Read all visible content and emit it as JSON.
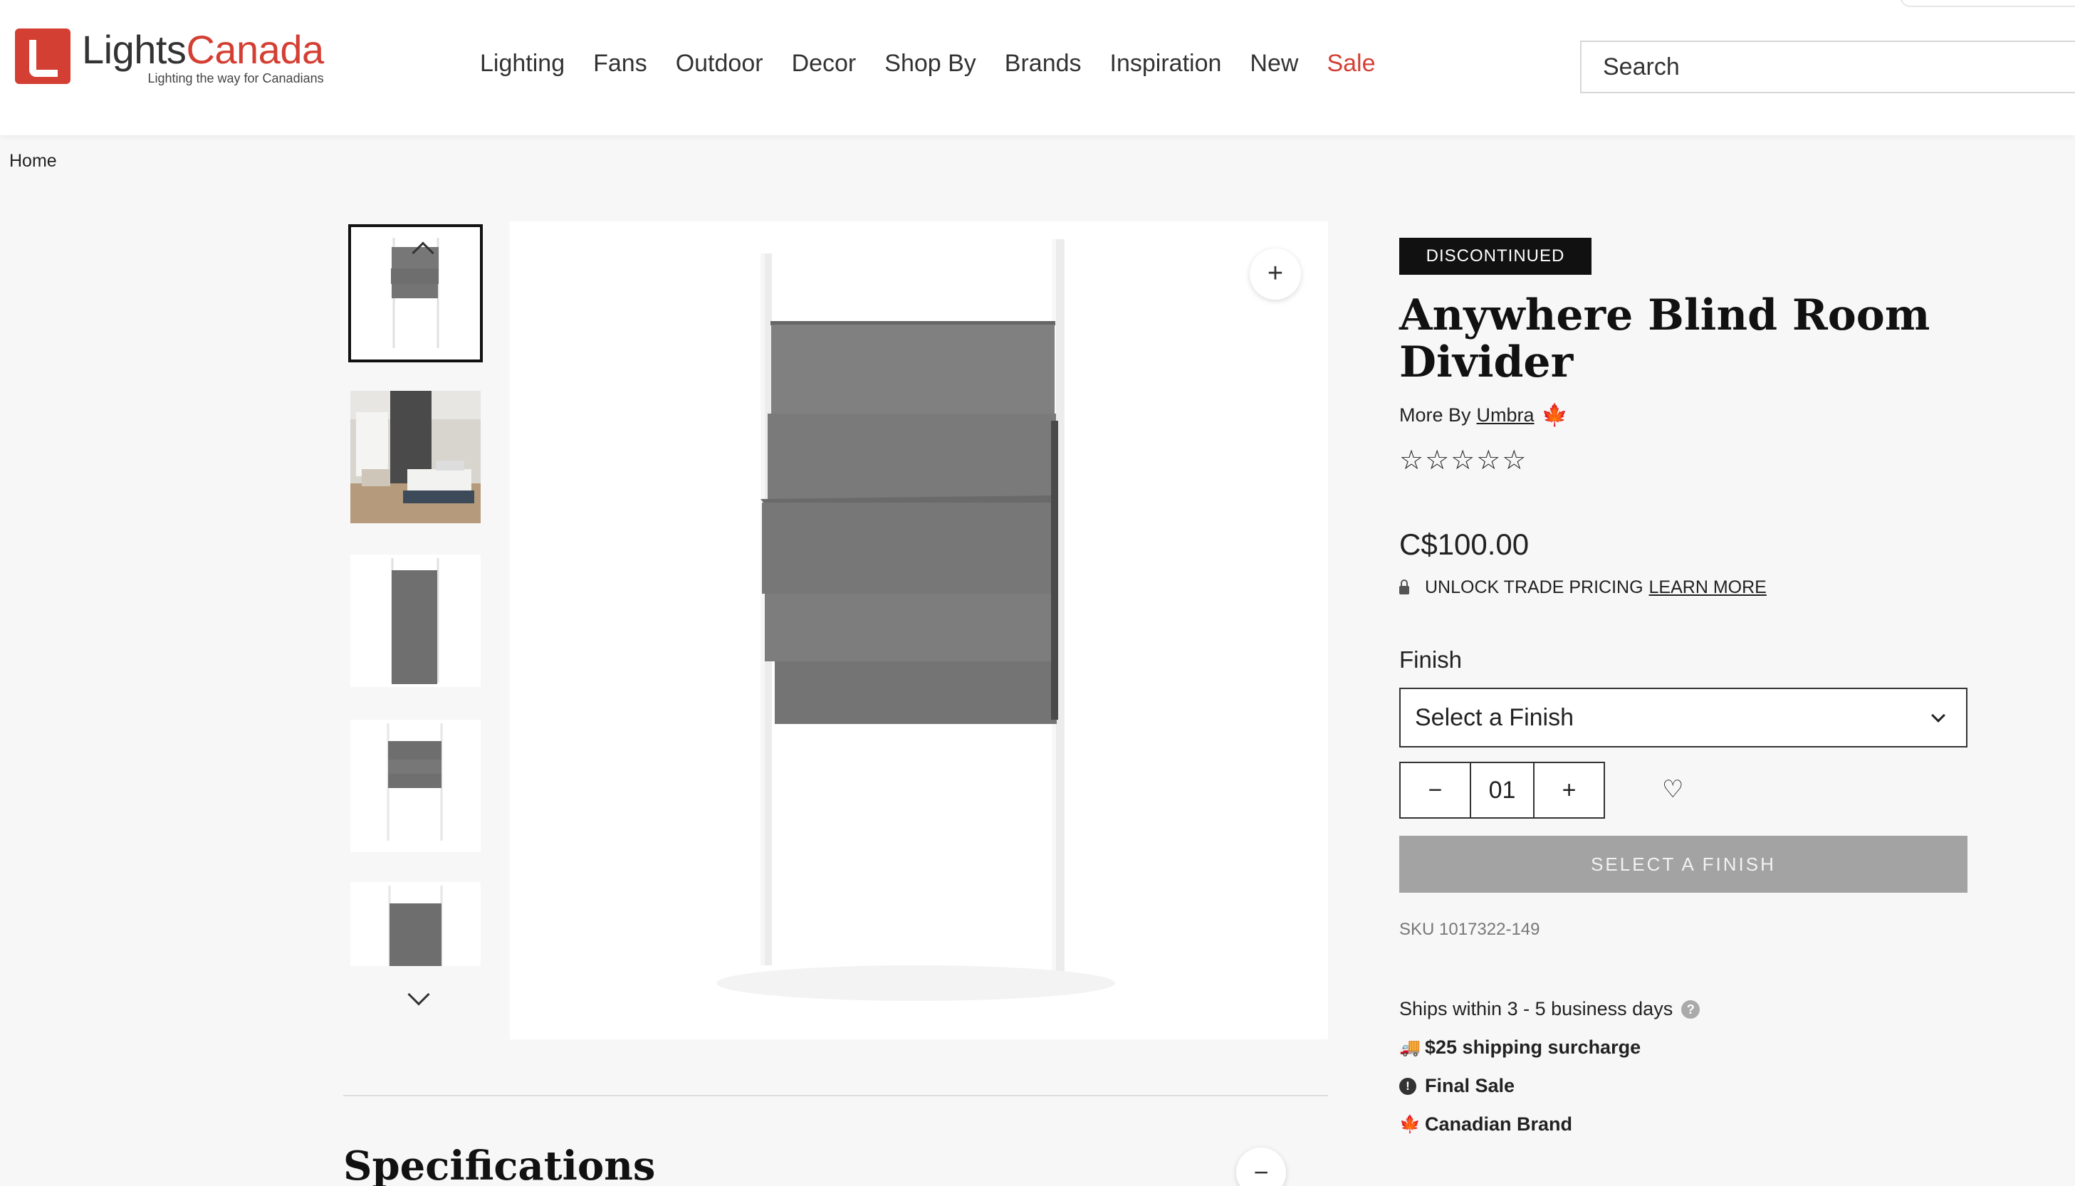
{
  "header": {
    "logo": {
      "name_part1": "Lights",
      "name_part2": "Canada",
      "tagline": "Lighting the way for Canadians"
    },
    "nav": [
      "Lighting",
      "Fans",
      "Outdoor",
      "Decor",
      "Shop By",
      "Brands",
      "Inspiration",
      "New"
    ],
    "sale_label": "Sale",
    "search_placeholder": "Search"
  },
  "breadcrumb": {
    "home": "Home"
  },
  "gallery": {
    "thumbnails": [
      "blind-divider-front",
      "blind-divider-bedroom",
      "blind-divider-tall",
      "blind-divider-short",
      "blind-divider-partial"
    ],
    "zoom_symbol": "+"
  },
  "product": {
    "badge": "DISCONTINUED",
    "title": "Anywhere Blind Room Divider",
    "more_by": "More By",
    "brand": "Umbra",
    "rating": {
      "value": 0,
      "max": 5,
      "stars": "☆☆☆☆☆"
    },
    "price": "C$100.00",
    "trade_text": "UNLOCK TRADE PRICING",
    "trade_link": "LEARN MORE",
    "finish_label": "Finish",
    "finish_select": "Select a Finish",
    "quantity": "01",
    "qty_minus": "−",
    "qty_plus": "+",
    "add_button": "SELECT A FINISH",
    "sku": "SKU 1017322-149",
    "ships": "Ships within 3 - 5 business days",
    "shipping_surcharge": "$25 shipping surcharge",
    "final_sale": "Final Sale",
    "canadian_brand": "Canadian Brand"
  },
  "specifications": {
    "title": "Specifications",
    "toggle": "−"
  },
  "colors": {
    "brand_red": "#d43f33",
    "badge_bg": "#111111",
    "button_disabled": "#a3a3a3"
  }
}
